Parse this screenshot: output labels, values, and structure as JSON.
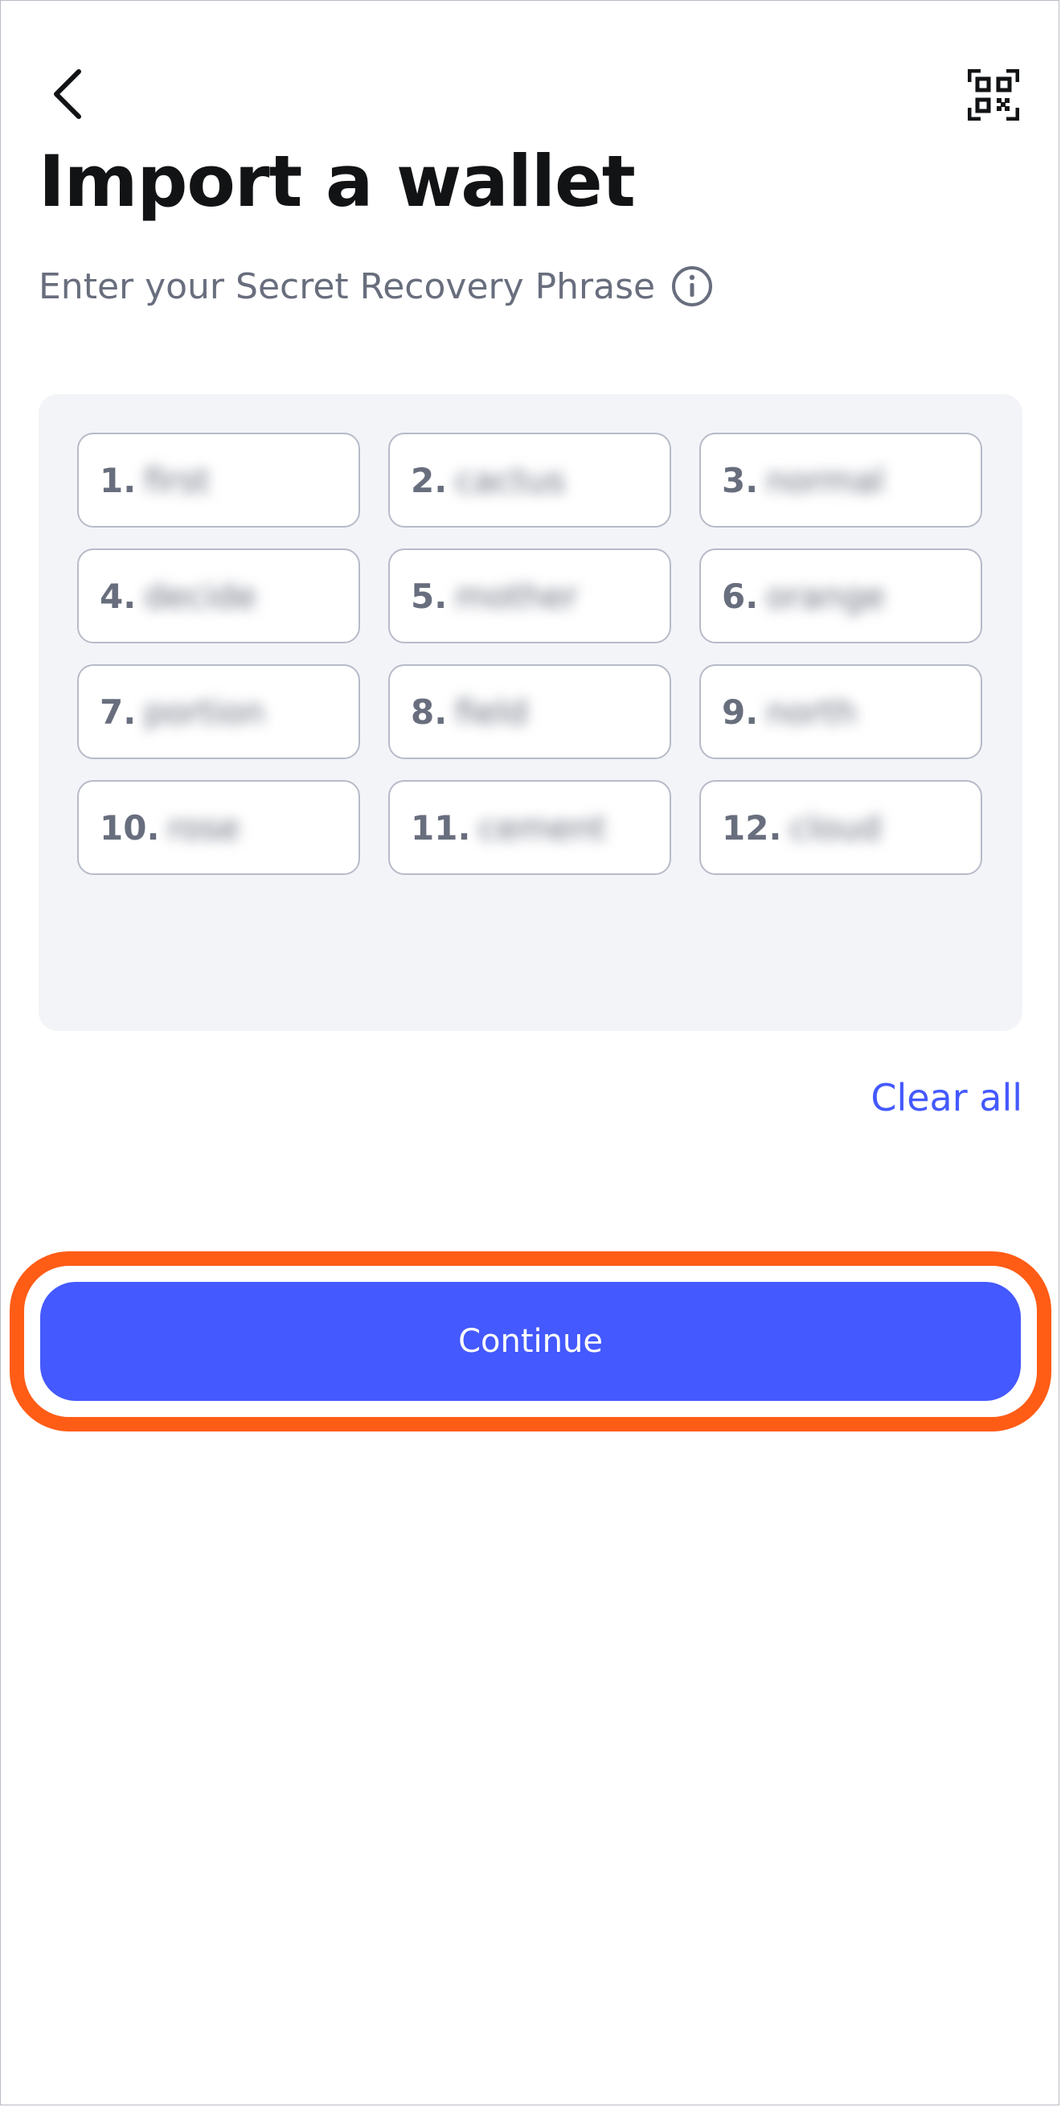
{
  "header": {
    "back_icon": "chevron-left-icon",
    "scan_icon": "qr-scan-icon"
  },
  "title": "Import a wallet",
  "subtitle": "Enter your Secret Recovery Phrase",
  "info_icon": "info-circle-icon",
  "srp_words": [
    {
      "num": "1.",
      "word": "first"
    },
    {
      "num": "2.",
      "word": "cactus"
    },
    {
      "num": "3.",
      "word": "normal"
    },
    {
      "num": "4.",
      "word": "decide"
    },
    {
      "num": "5.",
      "word": "mother"
    },
    {
      "num": "6.",
      "word": "orange"
    },
    {
      "num": "7.",
      "word": "portion"
    },
    {
      "num": "8.",
      "word": "field"
    },
    {
      "num": "9.",
      "word": "north"
    },
    {
      "num": "10.",
      "word": "rose"
    },
    {
      "num": "11.",
      "word": "cement"
    },
    {
      "num": "12.",
      "word": "cloud"
    }
  ],
  "clear_all_label": "Clear all",
  "continue_label": "Continue",
  "colors": {
    "accent": "#4459ff",
    "highlight": "#ff5c16",
    "panel_bg": "#f3f4f8",
    "text_muted": "#686e7d",
    "title_text": "#121314"
  }
}
